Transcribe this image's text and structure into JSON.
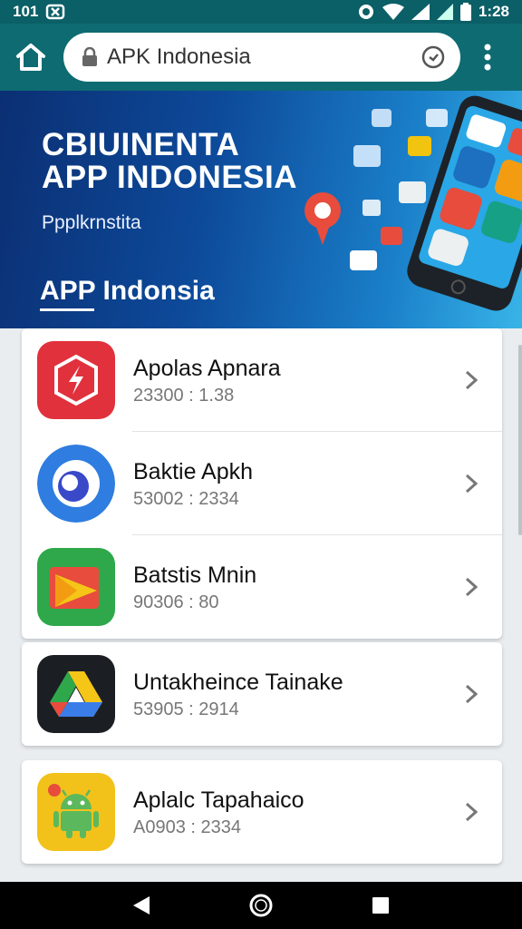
{
  "status_bar": {
    "time": "1:28",
    "left_text": "101",
    "icons": [
      "notification-icon",
      "target-icon",
      "wifi-icon",
      "signal-icon",
      "battery-icon"
    ]
  },
  "browser": {
    "url": "APK Indonesia",
    "icons": [
      "home-icon",
      "lock-icon",
      "refresh-icon",
      "more-vert-icon"
    ]
  },
  "hero": {
    "title_line1": "CBIUINENTA",
    "title_line2": "APP INDONESIA",
    "subtitle": "Ppplkrnstita",
    "section_label": "APP Indonsia"
  },
  "apps": [
    {
      "name": "Apolas Apnara",
      "meta": "23300 : 1.38",
      "icon": "red-app-icon",
      "color": "#e0313c"
    },
    {
      "name": "Baktie Apkh",
      "meta": "53002 : 2334",
      "icon": "blue-app-icon",
      "color": "#2f7de0"
    },
    {
      "name": "Batstis Mnin",
      "meta": "90306 : 80",
      "icon": "play-app-icon",
      "color": "#2ea84a"
    },
    {
      "name": "Untakheince Tainake",
      "meta": "53905 : 2914",
      "icon": "drive-app-icon",
      "color": "#1b1f24"
    },
    {
      "name": "Aplalc Tapahaico",
      "meta": "A0903 : 2334",
      "icon": "android-app-icon",
      "color": "#f2c21b"
    }
  ],
  "nav": {
    "icons": [
      "back-icon",
      "home-circle-icon",
      "recents-icon"
    ]
  },
  "colors": {
    "status_bar": "#0b5f66",
    "browser_bar": "#0e6b72",
    "chevron": "#777777"
  }
}
